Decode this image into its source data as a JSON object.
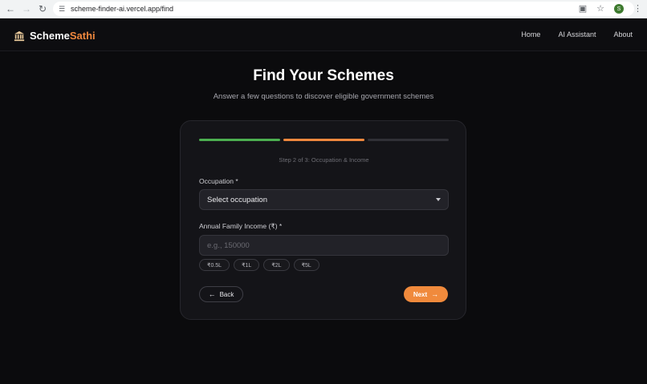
{
  "browser": {
    "url": "scheme-finder-ai.vercel.app/find",
    "profile_initial": "S"
  },
  "header": {
    "brand_main": "Scheme",
    "brand_accent": "Sathi",
    "nav": [
      "Home",
      "AI Assistant",
      "About"
    ]
  },
  "hero": {
    "title": "Find Your Schemes",
    "subtitle": "Answer a few questions to discover eligible government schemes"
  },
  "form": {
    "step_label": "Step 2 of 3: Occupation & Income",
    "progress": {
      "total_steps": 3,
      "current_step": 2,
      "colors": [
        "#4caf50",
        "#f0883e",
        "#303036"
      ]
    },
    "occupation_label": "Occupation *",
    "occupation_value": "Select occupation",
    "income_label": "Annual Family Income (₹) *",
    "income_placeholder": "e.g., 150000",
    "income_chips": [
      "₹0.5L",
      "₹1L",
      "₹2L",
      "₹5L"
    ],
    "back_label": "Back",
    "next_label": "Next"
  },
  "colors": {
    "accent": "#f0883e",
    "success": "#4caf50",
    "background": "#0b0b0d",
    "card": "#141418"
  }
}
